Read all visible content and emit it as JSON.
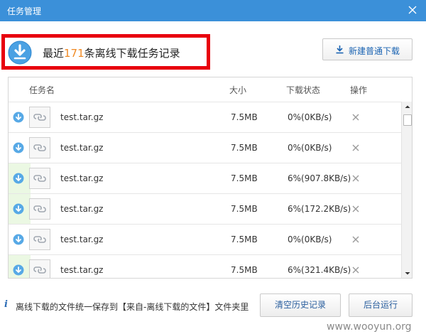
{
  "window": {
    "title": "任务管理"
  },
  "summary": {
    "prefix": "最近",
    "count": "171",
    "suffix": "条离线下载任务记录"
  },
  "toolbar": {
    "new_download_label": "新建普通下载"
  },
  "table": {
    "headers": {
      "name": "任务名",
      "size": "大小",
      "status": "下载状态",
      "action": "操作"
    },
    "rows": [
      {
        "name": "test.tar.gz",
        "size": "7.5MB",
        "status": "0%(0KB/s)",
        "active": false
      },
      {
        "name": "test.tar.gz",
        "size": "7.5MB",
        "status": "0%(0KB/s)",
        "active": false
      },
      {
        "name": "test.tar.gz",
        "size": "7.5MB",
        "status": "6%(907.8KB/s)",
        "active": true
      },
      {
        "name": "test.tar.gz",
        "size": "7.5MB",
        "status": "6%(172.2KB/s)",
        "active": true
      },
      {
        "name": "test.tar.gz",
        "size": "7.5MB",
        "status": "0%(0KB/s)",
        "active": false
      },
      {
        "name": "test.tar.gz",
        "size": "7.5MB",
        "status": "6%(321.4KB/s)",
        "active": true
      }
    ]
  },
  "footer": {
    "info_icon": "i",
    "info_text": "离线下载的文件统一保存到【来自-离线下载的文件】文件夹里",
    "clear_history_label": "清空历史记录",
    "background_label": "后台运行"
  },
  "watermark": "www.wooyun.org",
  "colors": {
    "titlebar": "#3b90d9",
    "accent_orange": "#f08a24",
    "highlight_red": "#e8000c",
    "link_blue": "#1a63b2",
    "active_row_stripe": "#ebf8e3"
  }
}
